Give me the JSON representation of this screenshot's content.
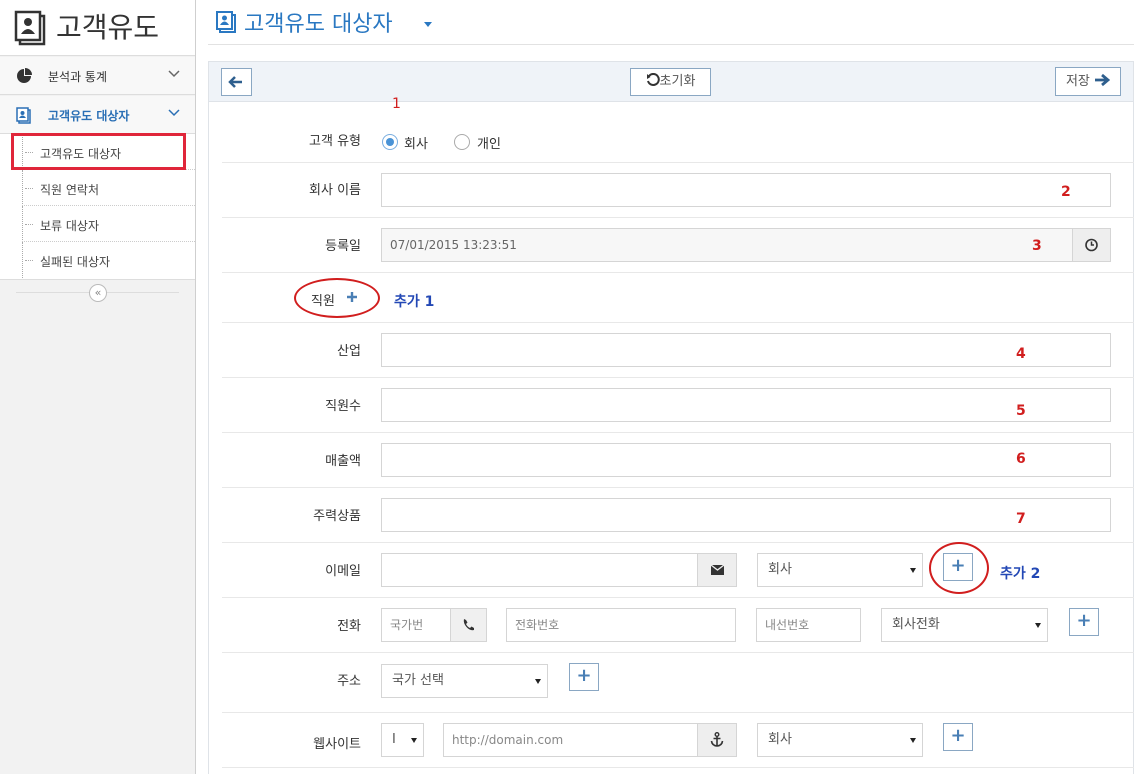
{
  "sidebar": {
    "brand_title": "고객유도",
    "nav": [
      {
        "label": "분석과 통계"
      },
      {
        "label": "고객유도 대상자"
      }
    ],
    "sub_items": [
      {
        "label": "고객유도 대상자"
      },
      {
        "label": "직원 연락처"
      },
      {
        "label": "보류 대상자"
      },
      {
        "label": "실패된 대상자"
      }
    ],
    "collapse_glyph": "«"
  },
  "header": {
    "title": "고객유도 대상자"
  },
  "toolbar": {
    "back_icon": "arrow-left-icon",
    "reset_label": "초기화",
    "save_label": "저장"
  },
  "form": {
    "customer_type": {
      "label": "고객 유형",
      "options": [
        "회사",
        "개인"
      ],
      "selected": "회사"
    },
    "company_name": {
      "label": "회사 이름",
      "value": ""
    },
    "registration_date": {
      "label": "등록일",
      "value": "07/01/2015 13:23:51"
    },
    "employee": {
      "label": "직원"
    },
    "industry": {
      "label": "산업",
      "value": ""
    },
    "employee_count": {
      "label": "직원수",
      "value": ""
    },
    "revenue": {
      "label": "매출액",
      "value": ""
    },
    "main_product": {
      "label": "주력상품",
      "value": ""
    },
    "email": {
      "label": "이메일",
      "value": "",
      "type_select": "회사"
    },
    "phone": {
      "label": "전화",
      "country_placeholder": "국가번",
      "number_placeholder": "전화번호",
      "ext_placeholder": "내선번호",
      "type_select": "회사전화"
    },
    "address": {
      "label": "주소",
      "country_select": "국가 선택"
    },
    "website": {
      "label": "웹사이트",
      "prefix_select": "I",
      "url_placeholder": "http://domain.com",
      "type_select": "회사"
    }
  },
  "annotations": {
    "n1": "1",
    "n2": "2",
    "n3": "3",
    "n4": "4",
    "n5": "5",
    "n6": "6",
    "n7": "7",
    "add1": "추가 1",
    "add2": "추가 2"
  },
  "colors": {
    "accent": "#2a78c2",
    "annotation_red": "#d11e1e",
    "annotation_blue": "#2348b5"
  }
}
